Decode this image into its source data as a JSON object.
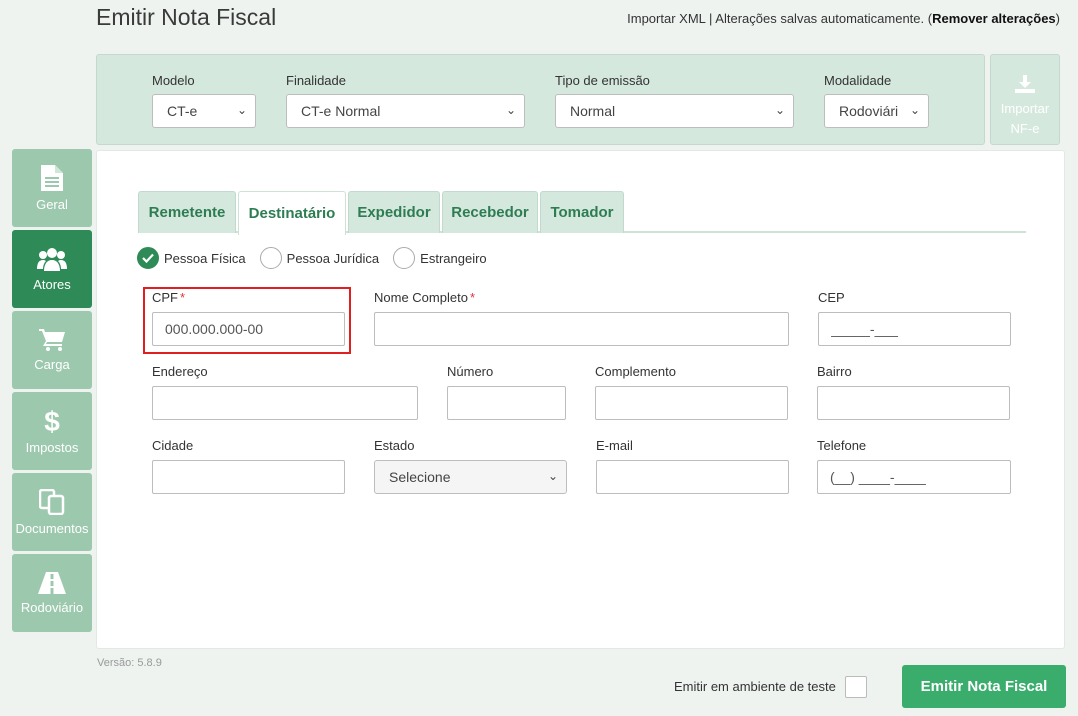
{
  "header": {
    "title": "Emitir Nota Fiscal",
    "import_xml": "Importar XML",
    "separator": " | ",
    "autosave_text": "Alterações salvas automaticamente. (",
    "remove_changes": "Remover alterações",
    "close_paren": ")"
  },
  "config": {
    "modelo": {
      "label": "Modelo",
      "value": "CT-e"
    },
    "finalidade": {
      "label": "Finalidade",
      "value": "CT-e Normal"
    },
    "tipo_emissao": {
      "label": "Tipo de emissão",
      "value": "Normal"
    },
    "modalidade": {
      "label": "Modalidade",
      "value": "Rodoviári"
    },
    "import_nfe": "Importar NF-e"
  },
  "sidebar": {
    "items": [
      {
        "label": "Geral",
        "icon": "document-icon",
        "active": false
      },
      {
        "label": "Atores",
        "icon": "users-icon",
        "active": true
      },
      {
        "label": "Carga",
        "icon": "cart-icon",
        "active": false
      },
      {
        "label": "Impostos",
        "icon": "dollar-icon",
        "active": false
      },
      {
        "label": "Documentos",
        "icon": "copy-icon",
        "active": false
      },
      {
        "label": "Rodoviário",
        "icon": "road-icon",
        "active": false
      }
    ]
  },
  "tabs": [
    {
      "label": "Remetente",
      "active": false
    },
    {
      "label": "Destinatário",
      "active": true
    },
    {
      "label": "Expedidor",
      "active": false
    },
    {
      "label": "Recebedor",
      "active": false
    },
    {
      "label": "Tomador",
      "active": false
    }
  ],
  "person_type": {
    "options": [
      "Pessoa Física",
      "Pessoa Jurídica",
      "Estrangeiro"
    ],
    "selected": "Pessoa Física"
  },
  "form": {
    "cpf": {
      "label": "CPF",
      "required": "*",
      "placeholder": "000.000.000-00"
    },
    "nome": {
      "label": "Nome Completo",
      "required": "*",
      "placeholder": ""
    },
    "cep": {
      "label": "CEP",
      "placeholder": "_____-___"
    },
    "endereco": {
      "label": "Endereço",
      "placeholder": ""
    },
    "numero": {
      "label": "Número",
      "placeholder": ""
    },
    "complemento": {
      "label": "Complemento",
      "placeholder": ""
    },
    "bairro": {
      "label": "Bairro",
      "placeholder": ""
    },
    "cidade": {
      "label": "Cidade",
      "placeholder": ""
    },
    "estado": {
      "label": "Estado",
      "value": "Selecione"
    },
    "email": {
      "label": "E-mail",
      "placeholder": ""
    },
    "telefone": {
      "label": "Telefone",
      "placeholder": "(__) ____-____"
    }
  },
  "footer": {
    "version": "Versão: 5.8.9",
    "test_env": "Emitir em ambiente de teste",
    "emit_button": "Emitir Nota Fiscal"
  },
  "colors": {
    "primary": "#2e8b57",
    "sidebar_inactive": "#9cc8ae",
    "panel_bg": "#d5e8de",
    "emit_button": "#3aad6d",
    "highlight": "#e02020"
  }
}
